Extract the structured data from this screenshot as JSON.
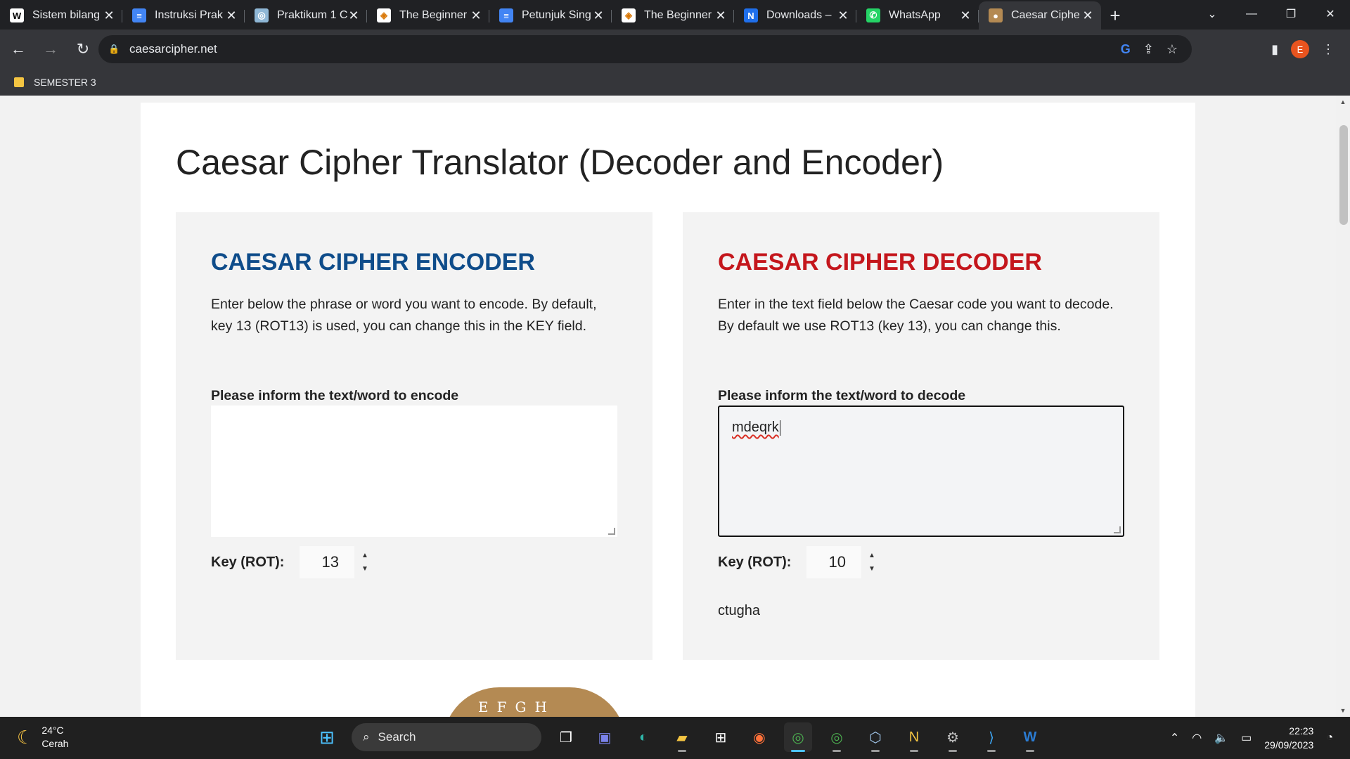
{
  "browser": {
    "tabs": [
      {
        "title": "Sistem bilang",
        "icon": "W",
        "color": "#ffffff",
        "fg": "#000000"
      },
      {
        "title": "Instruksi Prak",
        "icon": "≡",
        "color": "#4285f4",
        "fg": "#ffffff"
      },
      {
        "title": "Praktikum 1 C",
        "icon": "◎",
        "color": "#8fb7d6",
        "fg": "#ffffff"
      },
      {
        "title": "The Beginner",
        "icon": "◈",
        "color": "#ffffff",
        "fg": "#d97706"
      },
      {
        "title": "Petunjuk Sing",
        "icon": "≡",
        "color": "#4285f4",
        "fg": "#ffffff"
      },
      {
        "title": "The Beginner",
        "icon": "◈",
        "color": "#ffffff",
        "fg": "#d97706"
      },
      {
        "title": "Downloads –",
        "icon": "N",
        "color": "#1f6feb",
        "fg": "#ffffff"
      },
      {
        "title": "WhatsApp",
        "icon": "✆",
        "color": "#25d366",
        "fg": "#ffffff"
      },
      {
        "title": "Caesar Ciphe",
        "icon": "●",
        "color": "#b48a53",
        "fg": "#ffffff",
        "active": true
      }
    ],
    "url": "caesarcipher.net",
    "profile_initial": "E",
    "bookmark": "SEMESTER 3"
  },
  "page": {
    "title": "Caesar Cipher Translator (Decoder and Encoder)",
    "encoder": {
      "heading": "CAESAR CIPHER ENCODER",
      "description": "Enter below the phrase or word you want to encode. By default, key 13 (ROT13) is used, you can change this in the KEY field.",
      "label": "Please inform the text/word to encode",
      "text": "",
      "key_label": "Key (ROT):",
      "key": "13"
    },
    "decoder": {
      "heading": "CAESAR CIPHER DECODER",
      "description": "Enter in the text field below the Caesar code you want to decode. By default we use ROT13 (key 13), you can change this.",
      "label": "Please inform the text/word to decode",
      "text": "mdeqrk",
      "key_label": "Key (ROT):",
      "key": "10",
      "output": "ctugha"
    },
    "wheel_text": "EFGH"
  },
  "taskbar": {
    "temperature": "24°C",
    "weather": "Cerah",
    "search": "Search",
    "time": "22:23",
    "date": "29/09/2023"
  }
}
